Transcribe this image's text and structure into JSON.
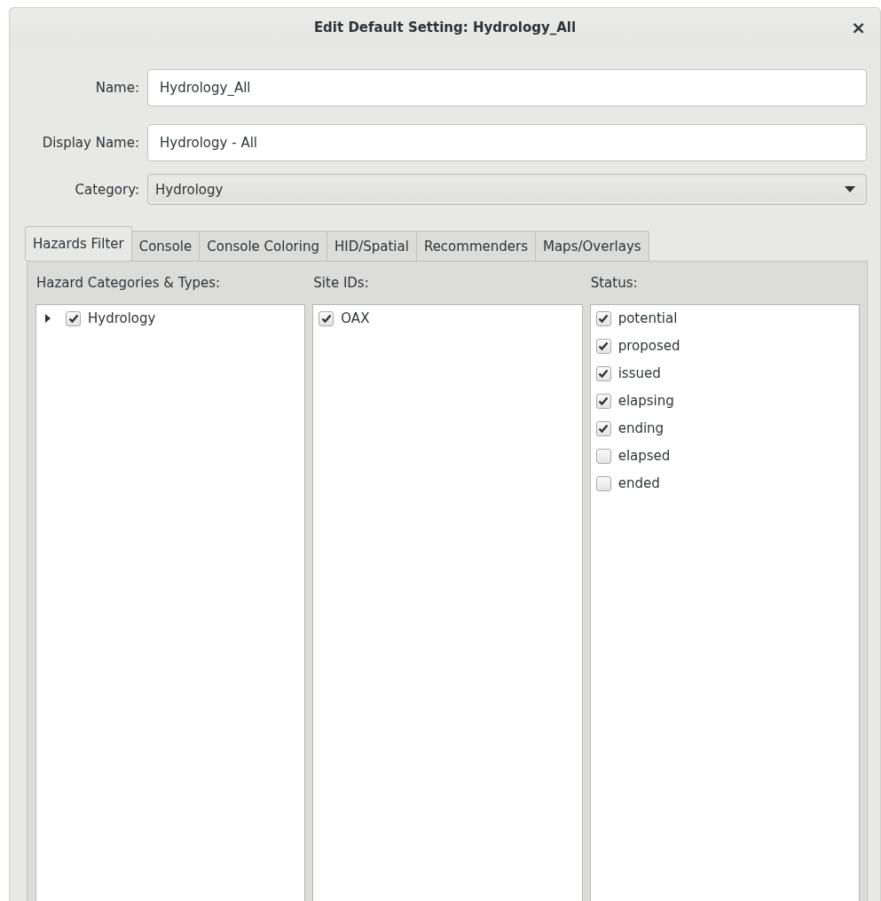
{
  "window": {
    "title": "Edit Default Setting: Hydrology_All",
    "close": "×"
  },
  "form": {
    "name": {
      "label": "Name:",
      "value": "Hydrology_All"
    },
    "display_name": {
      "label": "Display Name:",
      "value": "Hydrology - All"
    },
    "category": {
      "label": "Category:",
      "value": "Hydrology"
    }
  },
  "tabs": [
    {
      "label": "Hazards Filter",
      "selected": true
    },
    {
      "label": "Console",
      "selected": false
    },
    {
      "label": "Console Coloring",
      "selected": false
    },
    {
      "label": "HID/Spatial",
      "selected": false
    },
    {
      "label": "Recommenders",
      "selected": false
    },
    {
      "label": "Maps/Overlays",
      "selected": false
    }
  ],
  "columns": [
    {
      "heading": "Hazard Categories & Types:",
      "items": [
        {
          "label": "Hydrology",
          "checked": true,
          "expanded": false
        }
      ]
    },
    {
      "heading": "Site IDs:",
      "items": [
        {
          "label": "OAX",
          "checked": true
        }
      ]
    },
    {
      "heading": "Status:",
      "items": [
        {
          "label": "potential",
          "checked": true
        },
        {
          "label": "proposed",
          "checked": true
        },
        {
          "label": "issued",
          "checked": true
        },
        {
          "label": "elapsing",
          "checked": true
        },
        {
          "label": "ending",
          "checked": true
        },
        {
          "label": "elapsed",
          "checked": false
        },
        {
          "label": "ended",
          "checked": false
        }
      ]
    }
  ]
}
